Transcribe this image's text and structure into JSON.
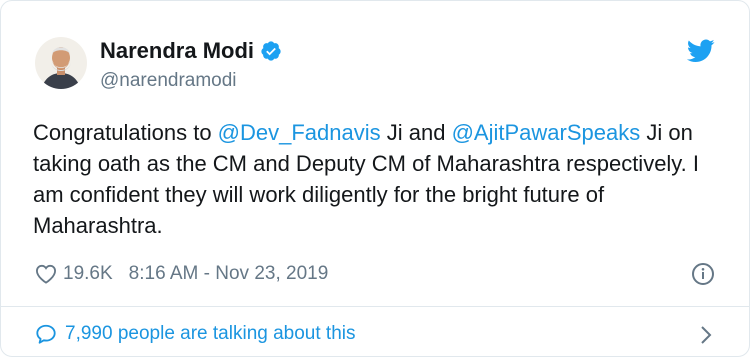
{
  "author": {
    "name": "Narendra Modi",
    "handle": "@narendramodi"
  },
  "tweet": {
    "text_1": "Congratulations to ",
    "mention_1": "@Dev_Fadnavis",
    "text_2": " Ji and ",
    "mention_2": "@AjitPawarSpeaks",
    "text_3": " Ji on taking oath as the CM and Deputy CM of Maharashtra respectively. I am confident they will work diligently for the bright future of Maharashtra."
  },
  "meta": {
    "likes": "19.6K",
    "timestamp": "8:16 AM - Nov 23, 2019"
  },
  "footer": {
    "talking": "7,990 people are talking about this"
  },
  "icons": {
    "verified": "verified-badge-icon",
    "brand": "twitter-bird-icon",
    "like": "heart-icon",
    "info": "info-icon",
    "reply": "speech-bubble-icon",
    "more": "chevron-right-icon"
  },
  "colors": {
    "accent": "#1da1f2",
    "link": "#1b95e0",
    "muted": "#657786",
    "text": "#14171a",
    "border": "#e1e8ed"
  }
}
